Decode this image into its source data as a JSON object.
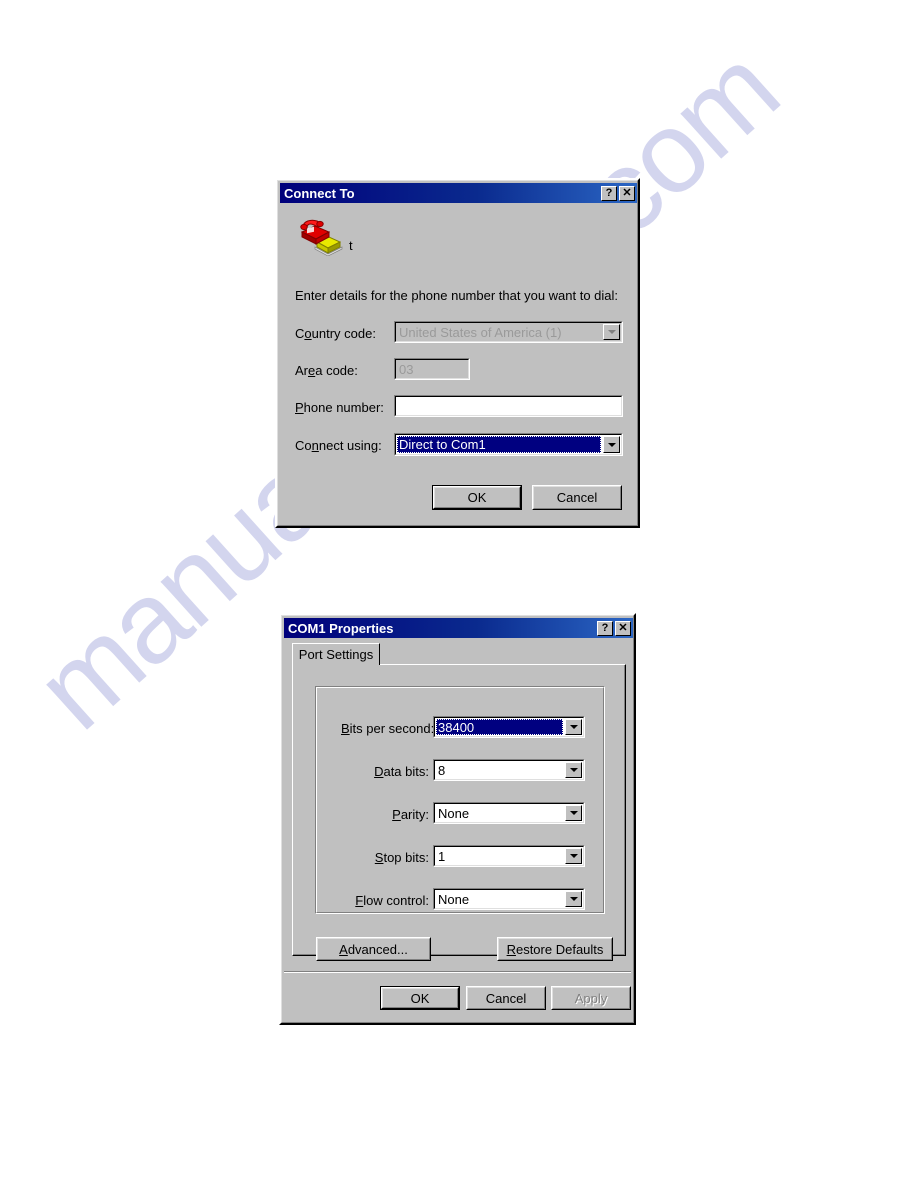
{
  "page": {
    "watermark_text": "manualarchive.com",
    "background_color": "#ffffff"
  },
  "dialogs": [
    {
      "id": "connect-to",
      "title": "Connect To",
      "titlebar_buttons": [
        {
          "name": "help-button",
          "glyph": "?"
        },
        {
          "name": "close-button",
          "glyph": "✕"
        }
      ],
      "connection_icon": "telephone-modem-icon",
      "connection_name": "t",
      "instruction": "Enter details for the phone number that you want to dial:",
      "fields": [
        {
          "label_before": "C",
          "label_accel": "o",
          "label_after": "untry code:",
          "label_full": "Country code:",
          "value": "United States of America (1)",
          "control": "combobox",
          "disabled": true,
          "selected": false
        },
        {
          "label_before": "Ar",
          "label_accel": "e",
          "label_after": "a code:",
          "label_full": "Area code:",
          "value": "03",
          "control": "textbox",
          "disabled": true,
          "selected": false
        },
        {
          "label_before": "",
          "label_accel": "P",
          "label_after": "hone number:",
          "label_full": "Phone number:",
          "value": "",
          "control": "textbox",
          "disabled": false,
          "selected": false
        },
        {
          "label_before": "Co",
          "label_accel": "n",
          "label_after": "nect using:",
          "label_full": "Connect using:",
          "value": "Direct to Com1",
          "control": "combobox",
          "disabled": false,
          "selected": true
        }
      ],
      "buttons": [
        {
          "name": "ok-button",
          "label": "OK",
          "default": true,
          "disabled": false
        },
        {
          "name": "cancel-button",
          "label": "Cancel",
          "default": false,
          "disabled": false
        }
      ]
    },
    {
      "id": "com1-properties",
      "title": "COM1 Properties",
      "titlebar_buttons": [
        {
          "name": "help-button",
          "glyph": "?"
        },
        {
          "name": "close-button",
          "glyph": "✕"
        }
      ],
      "tabs": [
        {
          "name": "tab-port-settings",
          "label": "Port Settings",
          "active": true
        }
      ],
      "fields": [
        {
          "label_before": "",
          "label_accel": "B",
          "label_after": "its per second:",
          "label_full": "Bits per second:",
          "value": "38400",
          "control": "combobox",
          "selected": true
        },
        {
          "label_before": "",
          "label_accel": "D",
          "label_after": "ata bits:",
          "label_full": "Data bits:",
          "value": "8",
          "control": "combobox",
          "selected": false
        },
        {
          "label_before": "",
          "label_accel": "P",
          "label_after": "arity:",
          "label_full": "Parity:",
          "value": "None",
          "control": "combobox",
          "selected": false
        },
        {
          "label_before": "",
          "label_accel": "S",
          "label_after": "top bits:",
          "label_full": "Stop bits:",
          "value": "1",
          "control": "combobox",
          "selected": false
        },
        {
          "label_before": "",
          "label_accel": "F",
          "label_after": "low control:",
          "label_full": "Flow control:",
          "value": "None",
          "control": "combobox",
          "selected": false
        }
      ],
      "panel_buttons": [
        {
          "name": "advanced-button",
          "label_before": "",
          "label_accel": "A",
          "label_after": "dvanced...",
          "label_full": "Advanced..."
        },
        {
          "name": "restore-defaults-button",
          "label_before": "",
          "label_accel": "R",
          "label_after": "estore Defaults",
          "label_full": "Restore Defaults"
        }
      ],
      "buttons": [
        {
          "name": "ok-button",
          "label": "OK",
          "default": true,
          "disabled": false
        },
        {
          "name": "cancel-button",
          "label": "Cancel",
          "default": false,
          "disabled": false
        },
        {
          "name": "apply-button",
          "label": "Apply",
          "default": false,
          "disabled": true
        }
      ]
    }
  ]
}
